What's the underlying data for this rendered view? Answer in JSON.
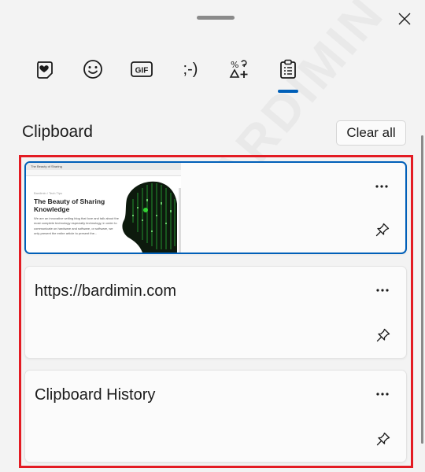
{
  "tabs": [
    {
      "name": "favorites",
      "icon": "heart-note-icon"
    },
    {
      "name": "emoji",
      "icon": "smiley-icon"
    },
    {
      "name": "gif",
      "label": "GIF",
      "icon": "gif-icon"
    },
    {
      "name": "kaomoji",
      "label": ";-)",
      "icon": "kaomoji-icon"
    },
    {
      "name": "symbols",
      "icon": "symbols-icon"
    },
    {
      "name": "clipboard",
      "icon": "clipboard-icon",
      "selected": true
    }
  ],
  "clipboard": {
    "title": "Clipboard",
    "clear_all_label": "Clear all",
    "items": [
      {
        "type": "image",
        "selected": true,
        "thumbnail": {
          "tab_title": "The Beauty of Sharing",
          "kicker": "Bardimin / Tech Tips",
          "title": "The Beauty of Sharing Knowledge",
          "paragraph": "We are an innovative writing blog that love and talk about the most complete technology especially technology, in order to communicate on hardware and software, or software, we only present the entire article to present the..."
        }
      },
      {
        "type": "text",
        "text": "https://bardimin.com"
      },
      {
        "type": "text",
        "text": "Clipboard History"
      }
    ]
  },
  "watermark": "BARDIMIN",
  "colors": {
    "accent": "#005fb8",
    "highlight_box": "#e31b23",
    "background": "#f3f3f3"
  }
}
